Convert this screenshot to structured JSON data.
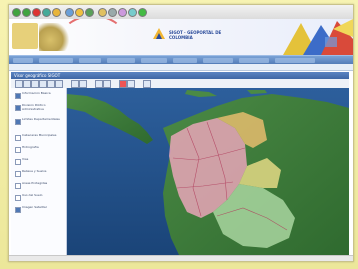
{
  "browser": {
    "toolbar_icons": [
      "back-icon",
      "forward-icon",
      "refresh-icon",
      "stop-icon",
      "home-icon",
      "search-icon",
      "favorites-icon",
      "history-icon",
      "mail-icon",
      "print-icon",
      "edit-icon",
      "discuss-icon",
      "messenger-icon"
    ]
  },
  "banner": {
    "logo_text": "SIGOT · GEOPORTAL DE COLOMBIA"
  },
  "nav": {
    "items": [
      "Inicio",
      "Información Básica",
      "Temas",
      "Geoportales",
      "Consultas",
      "Servicios",
      "Documentos",
      "Ayuda",
      "Contacto"
    ]
  },
  "panel": {
    "title": "Visor geográfico SIGOT"
  },
  "map_tools": [
    "zoom-in-icon",
    "zoom-out-icon",
    "pan-icon",
    "full-extent-icon",
    "identify-icon",
    "measure-icon",
    "print-icon",
    "layers-icon",
    "previous-extent-icon",
    "next-extent-icon",
    "select-icon",
    "clear-icon",
    "help-icon"
  ],
  "layers": [
    {
      "label": "Información Básica",
      "checked": true
    },
    {
      "label": "División Político Administrativa",
      "checked": true
    },
    {
      "label": "Límites Departamentales",
      "checked": true
    },
    {
      "label": "Cabeceras Municipales",
      "checked": false
    },
    {
      "label": "Hidrografía",
      "checked": false
    },
    {
      "label": "Vías",
      "checked": false
    },
    {
      "label": "Relieve y Suelos",
      "checked": false
    },
    {
      "label": "Áreas Protegidas",
      "checked": false
    },
    {
      "label": "Uso del Suelo",
      "checked": false
    },
    {
      "label": "Imagen Satelital",
      "checked": true
    }
  ],
  "colors": {
    "nav": "#4f78b5",
    "panel_header": "#3f67a5",
    "frame": "#f4f0a8",
    "ocean": "#1f4f8a",
    "land": "#3d7a3a",
    "department_pink": "#e9a6b8",
    "department_green": "#a9d6a0"
  }
}
